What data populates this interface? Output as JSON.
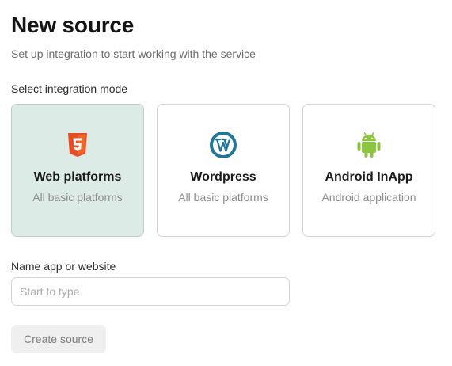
{
  "page": {
    "title": "New source",
    "subtitle": "Set up integration to start working with the service"
  },
  "mode_section": {
    "label": "Select integration mode",
    "cards": [
      {
        "title": "Web platforms",
        "description": "All basic platforms",
        "icon": "html5-icon",
        "selected": true
      },
      {
        "title": "Wordpress",
        "description": "All basic platforms",
        "icon": "wordpress-icon",
        "selected": false
      },
      {
        "title": "Android InApp",
        "description": "Android application",
        "icon": "android-icon",
        "selected": false
      }
    ]
  },
  "name_field": {
    "label": "Name app or website",
    "placeholder": "Start to type",
    "value": ""
  },
  "create_button": {
    "label": "Create source",
    "disabled": true
  },
  "colors": {
    "selected_card_bg": "#ddebe6",
    "html5_orange": "#e44d26",
    "wordpress_blue": "#21759b",
    "android_green": "#8cc63f"
  }
}
